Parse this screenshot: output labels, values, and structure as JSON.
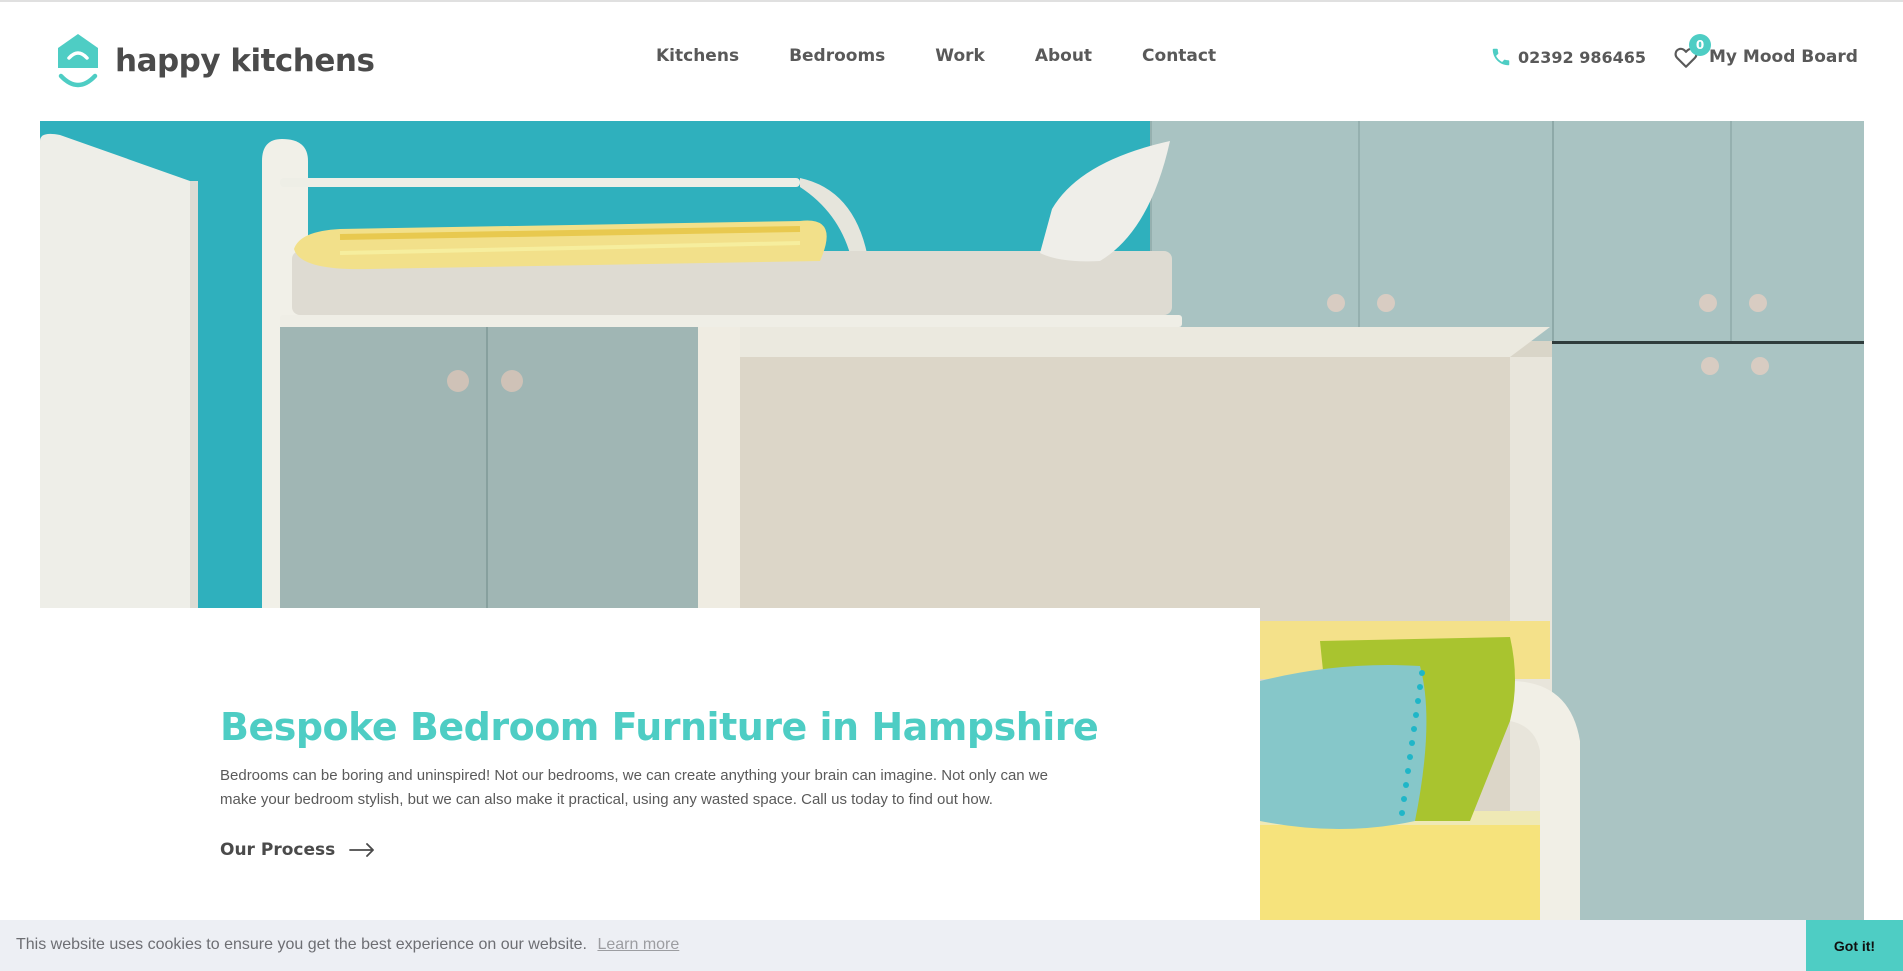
{
  "brand": {
    "name": "happy kitchens",
    "accent_color": "#4ecdc4",
    "logo_icon": "house-smile-icon"
  },
  "nav": {
    "items": [
      {
        "label": "Kitchens"
      },
      {
        "label": "Bedrooms"
      },
      {
        "label": "Work"
      },
      {
        "label": "About"
      },
      {
        "label": "Contact"
      }
    ]
  },
  "header": {
    "phone": "02392 986465",
    "phone_icon": "phone-icon",
    "mood_board_label": "My Mood Board",
    "mood_board_count": "0",
    "mood_board_icon": "heart-icon"
  },
  "hero": {
    "image": "bedroom-furniture-photo",
    "title": "Bespoke Bedroom Furniture in Hampshire",
    "description": "Bedrooms can be boring and uninspired! Not our bedrooms, we can create anything your brain can imagine. Not only can we make your bedroom stylish, but we can also make it practical, using any wasted space. Call us today to find out how.",
    "cta_label": "Our Process",
    "cta_icon": "arrow-right-icon"
  },
  "cookie": {
    "message": "This website uses cookies to ensure you get the best experience on our website.",
    "learn_more": "Learn more",
    "button": "Got it!"
  }
}
